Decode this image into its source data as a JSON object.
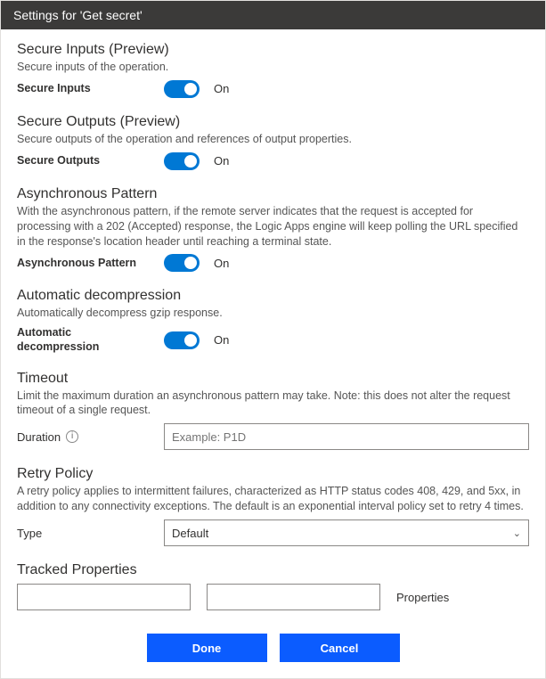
{
  "header": {
    "title": "Settings for 'Get secret'"
  },
  "sections": {
    "secureInputs": {
      "title": "Secure Inputs (Preview)",
      "desc": "Secure inputs of the operation.",
      "label": "Secure Inputs",
      "state": "On"
    },
    "secureOutputs": {
      "title": "Secure Outputs (Preview)",
      "desc": "Secure outputs of the operation and references of output properties.",
      "label": "Secure Outputs",
      "state": "On"
    },
    "asyncPattern": {
      "title": "Asynchronous Pattern",
      "desc": "With the asynchronous pattern, if the remote server indicates that the request is accepted for processing with a 202 (Accepted) response, the Logic Apps engine will keep polling the URL specified in the response's location header until reaching a terminal state.",
      "label": "Asynchronous Pattern",
      "state": "On"
    },
    "autoDecomp": {
      "title": "Automatic decompression",
      "desc": "Automatically decompress gzip response.",
      "label": "Automatic decompression",
      "state": "On"
    },
    "timeout": {
      "title": "Timeout",
      "desc": "Limit the maximum duration an asynchronous pattern may take. Note: this does not alter the request timeout of a single request.",
      "label": "Duration",
      "placeholder": "Example: P1D",
      "value": ""
    },
    "retry": {
      "title": "Retry Policy",
      "desc": "A retry policy applies to intermittent failures, characterized as HTTP status codes 408, 429, and 5xx, in addition to any connectivity exceptions. The default is an exponential interval policy set to retry 4 times.",
      "label": "Type",
      "selected": "Default"
    },
    "tracked": {
      "title": "Tracked Properties",
      "keyValue": "",
      "valValue": "",
      "propsLabel": "Properties"
    }
  },
  "footer": {
    "done": "Done",
    "cancel": "Cancel"
  }
}
